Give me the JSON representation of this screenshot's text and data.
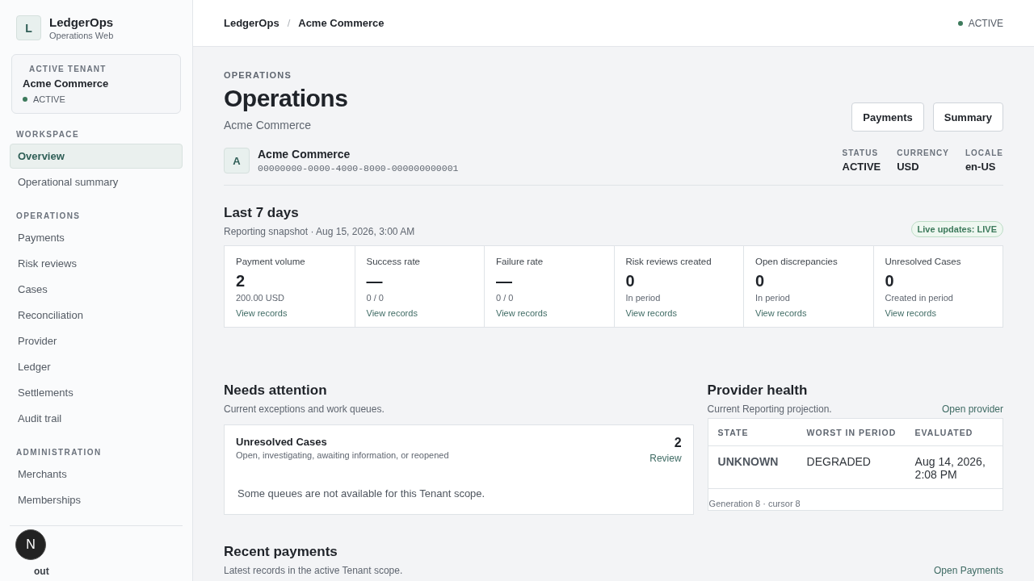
{
  "brand": {
    "initial": "L",
    "name": "LedgerOps",
    "subtitle": "Operations Web"
  },
  "tenant_card": {
    "label": "ACTIVE TENANT",
    "name": "Acme Commerce",
    "status": "ACTIVE",
    "active": true
  },
  "nav_sections": [
    {
      "title": "WORKSPACE",
      "items": [
        {
          "label": "Overview",
          "selected": true
        },
        {
          "label": "Operational summary",
          "selected": false
        }
      ]
    },
    {
      "title": "OPERATIONS",
      "items": [
        {
          "label": "Payments",
          "selected": false
        },
        {
          "label": "Risk reviews",
          "selected": false
        },
        {
          "label": "Cases",
          "selected": false
        },
        {
          "label": "Reconciliation",
          "selected": false
        },
        {
          "label": "Provider",
          "selected": false
        },
        {
          "label": "Ledger",
          "selected": false
        },
        {
          "label": "Settlements",
          "selected": false
        },
        {
          "label": "Audit trail",
          "selected": false
        }
      ]
    },
    {
      "title": "ADMINISTRATION",
      "items": [
        {
          "label": "Merchants",
          "selected": false
        },
        {
          "label": "Memberships",
          "selected": false
        }
      ]
    }
  ],
  "sign_out": "out",
  "dev_badge": "N",
  "breadcrumb": [
    "LedgerOps",
    "Acme Commerce"
  ],
  "breadcrumb_separator": "/",
  "header_status": {
    "label": "ACTIVE",
    "active": true
  },
  "page": {
    "eyebrow": "OPERATIONS",
    "title": "Operations",
    "subtitle": "Acme Commerce",
    "actions": [
      "Payments",
      "Summary"
    ]
  },
  "tenant": {
    "initial": "A",
    "name": "Acme Commerce",
    "id": "00000000-0000-4000-8000-000000000001",
    "facts": [
      {
        "label": "STATUS",
        "value": "ACTIVE"
      },
      {
        "label": "CURRENCY",
        "value": "USD"
      },
      {
        "label": "LOCALE",
        "value": "en-US"
      }
    ]
  },
  "period": {
    "title": "Last 7 days",
    "snapshot": "Reporting snapshot · Aug 15, 2026, 3:00 AM",
    "live_badge": "Live updates: LIVE"
  },
  "metrics": [
    {
      "label": "Payment volume",
      "value": "2",
      "detail": "200.00 USD",
      "link": "View records"
    },
    {
      "label": "Success rate",
      "value": "—",
      "detail": "0 / 0",
      "link": "View records"
    },
    {
      "label": "Failure rate",
      "value": "—",
      "detail": "0 / 0",
      "link": "View records"
    },
    {
      "label": "Risk reviews created",
      "value": "0",
      "detail": "In period",
      "link": "View records"
    },
    {
      "label": "Open discrepancies",
      "value": "0",
      "detail": "In period",
      "link": "View records"
    },
    {
      "label": "Unresolved Cases",
      "value": "0",
      "detail": "Created in period",
      "link": "View records"
    }
  ],
  "attention": {
    "title": "Needs attention",
    "subtitle": "Current exceptions and work queues.",
    "queues": [
      {
        "title": "Unresolved Cases",
        "description": "Open, investigating, awaiting information, or reopened",
        "count": "2",
        "action": "Review"
      }
    ],
    "note": "Some queues are not available for this Tenant scope."
  },
  "provider_health": {
    "title": "Provider health",
    "subtitle": "Current Reporting projection.",
    "link": "Open provider",
    "columns": [
      "STATE",
      "WORST IN PERIOD",
      "EVALUATED"
    ],
    "rows": [
      [
        "UNKNOWN",
        "DEGRADED",
        "Aug 14, 2026, 2:08 PM"
      ]
    ],
    "footer": "Generation 8 · cursor 8"
  },
  "recent_payments": {
    "title": "Recent payments",
    "subtitle": "Latest records in the active Tenant scope.",
    "link": "Open Payments"
  }
}
